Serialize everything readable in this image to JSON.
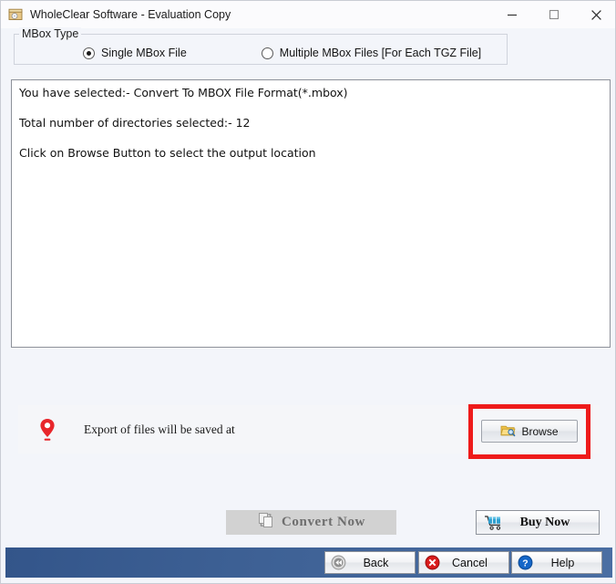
{
  "window": {
    "title": "WholeClear Software - Evaluation Copy",
    "app_icon": "archive-box-icon",
    "minimize_label": "Minimize",
    "maximize_label": "Maximize",
    "close_label": "Close"
  },
  "mbox_type": {
    "group_label": "MBox Type",
    "options": [
      {
        "label": "Single MBox File",
        "selected": true
      },
      {
        "label": "Multiple MBox Files [For Each TGZ File]",
        "selected": false
      }
    ]
  },
  "log": {
    "lines": [
      "You have selected:- Convert To MBOX File Format(*.mbox)",
      "Total number of directories selected:- 12",
      "Click on Browse Button to select the output location"
    ]
  },
  "export": {
    "pin_icon": "location-pin-icon",
    "label": "Export of files will be saved at",
    "browse_label": "Browse",
    "browse_icon": "folder-search-icon",
    "highlight_color": "#ee1b1b"
  },
  "actions": {
    "convert_label": "Convert Now",
    "convert_icon": "convert-pages-icon",
    "convert_disabled": true,
    "buy_label": "Buy Now",
    "buy_icon": "shopping-cart-icon"
  },
  "footer": {
    "bar_color": "#3d6094",
    "buttons": [
      {
        "label": "Back",
        "icon": "rewind-icon"
      },
      {
        "label": "Cancel",
        "icon": "cancel-x-icon"
      },
      {
        "label": "Help",
        "icon": "question-mark-icon"
      }
    ]
  }
}
